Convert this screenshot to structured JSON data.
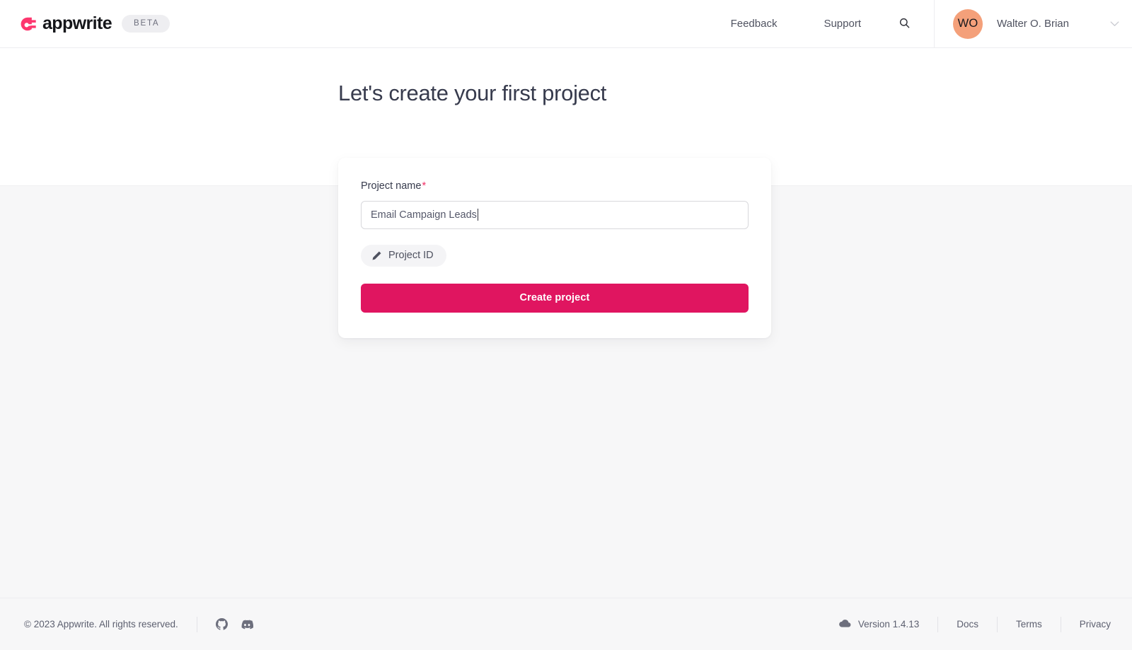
{
  "header": {
    "brand_name": "appwrite",
    "brand_badge": "BETA",
    "logo_icon": "appwrite-logo-icon",
    "nav": [
      {
        "label": "Feedback",
        "name": "nav-link-feedback"
      },
      {
        "label": "Support",
        "name": "nav-link-support"
      }
    ],
    "search_icon": "search-icon",
    "user": {
      "initials": "WO",
      "name": "Walter O. Brian",
      "avatar_color": "#f4a07a",
      "caret_icon": "chevron-down-icon"
    }
  },
  "main": {
    "title": "Let's create your first project",
    "form": {
      "project_name_label": "Project name",
      "required_marker": "*",
      "project_name_value": "Email Campaign Leads",
      "project_name_placeholder": "Project name",
      "project_id_button": "Project ID",
      "project_id_icon": "pencil-icon",
      "submit_label": "Create project",
      "submit_color": "#e01560"
    }
  },
  "footer": {
    "copyright": "© 2023 Appwrite. All rights reserved.",
    "social": [
      {
        "name": "github-icon",
        "title": "GitHub"
      },
      {
        "name": "discord-icon",
        "title": "Discord"
      }
    ],
    "version_icon": "cloud-icon",
    "version_label": "Version 1.4.13",
    "links": [
      {
        "label": "Docs",
        "name": "footer-link-docs"
      },
      {
        "label": "Terms",
        "name": "footer-link-terms"
      },
      {
        "label": "Privacy",
        "name": "footer-link-privacy"
      }
    ]
  }
}
